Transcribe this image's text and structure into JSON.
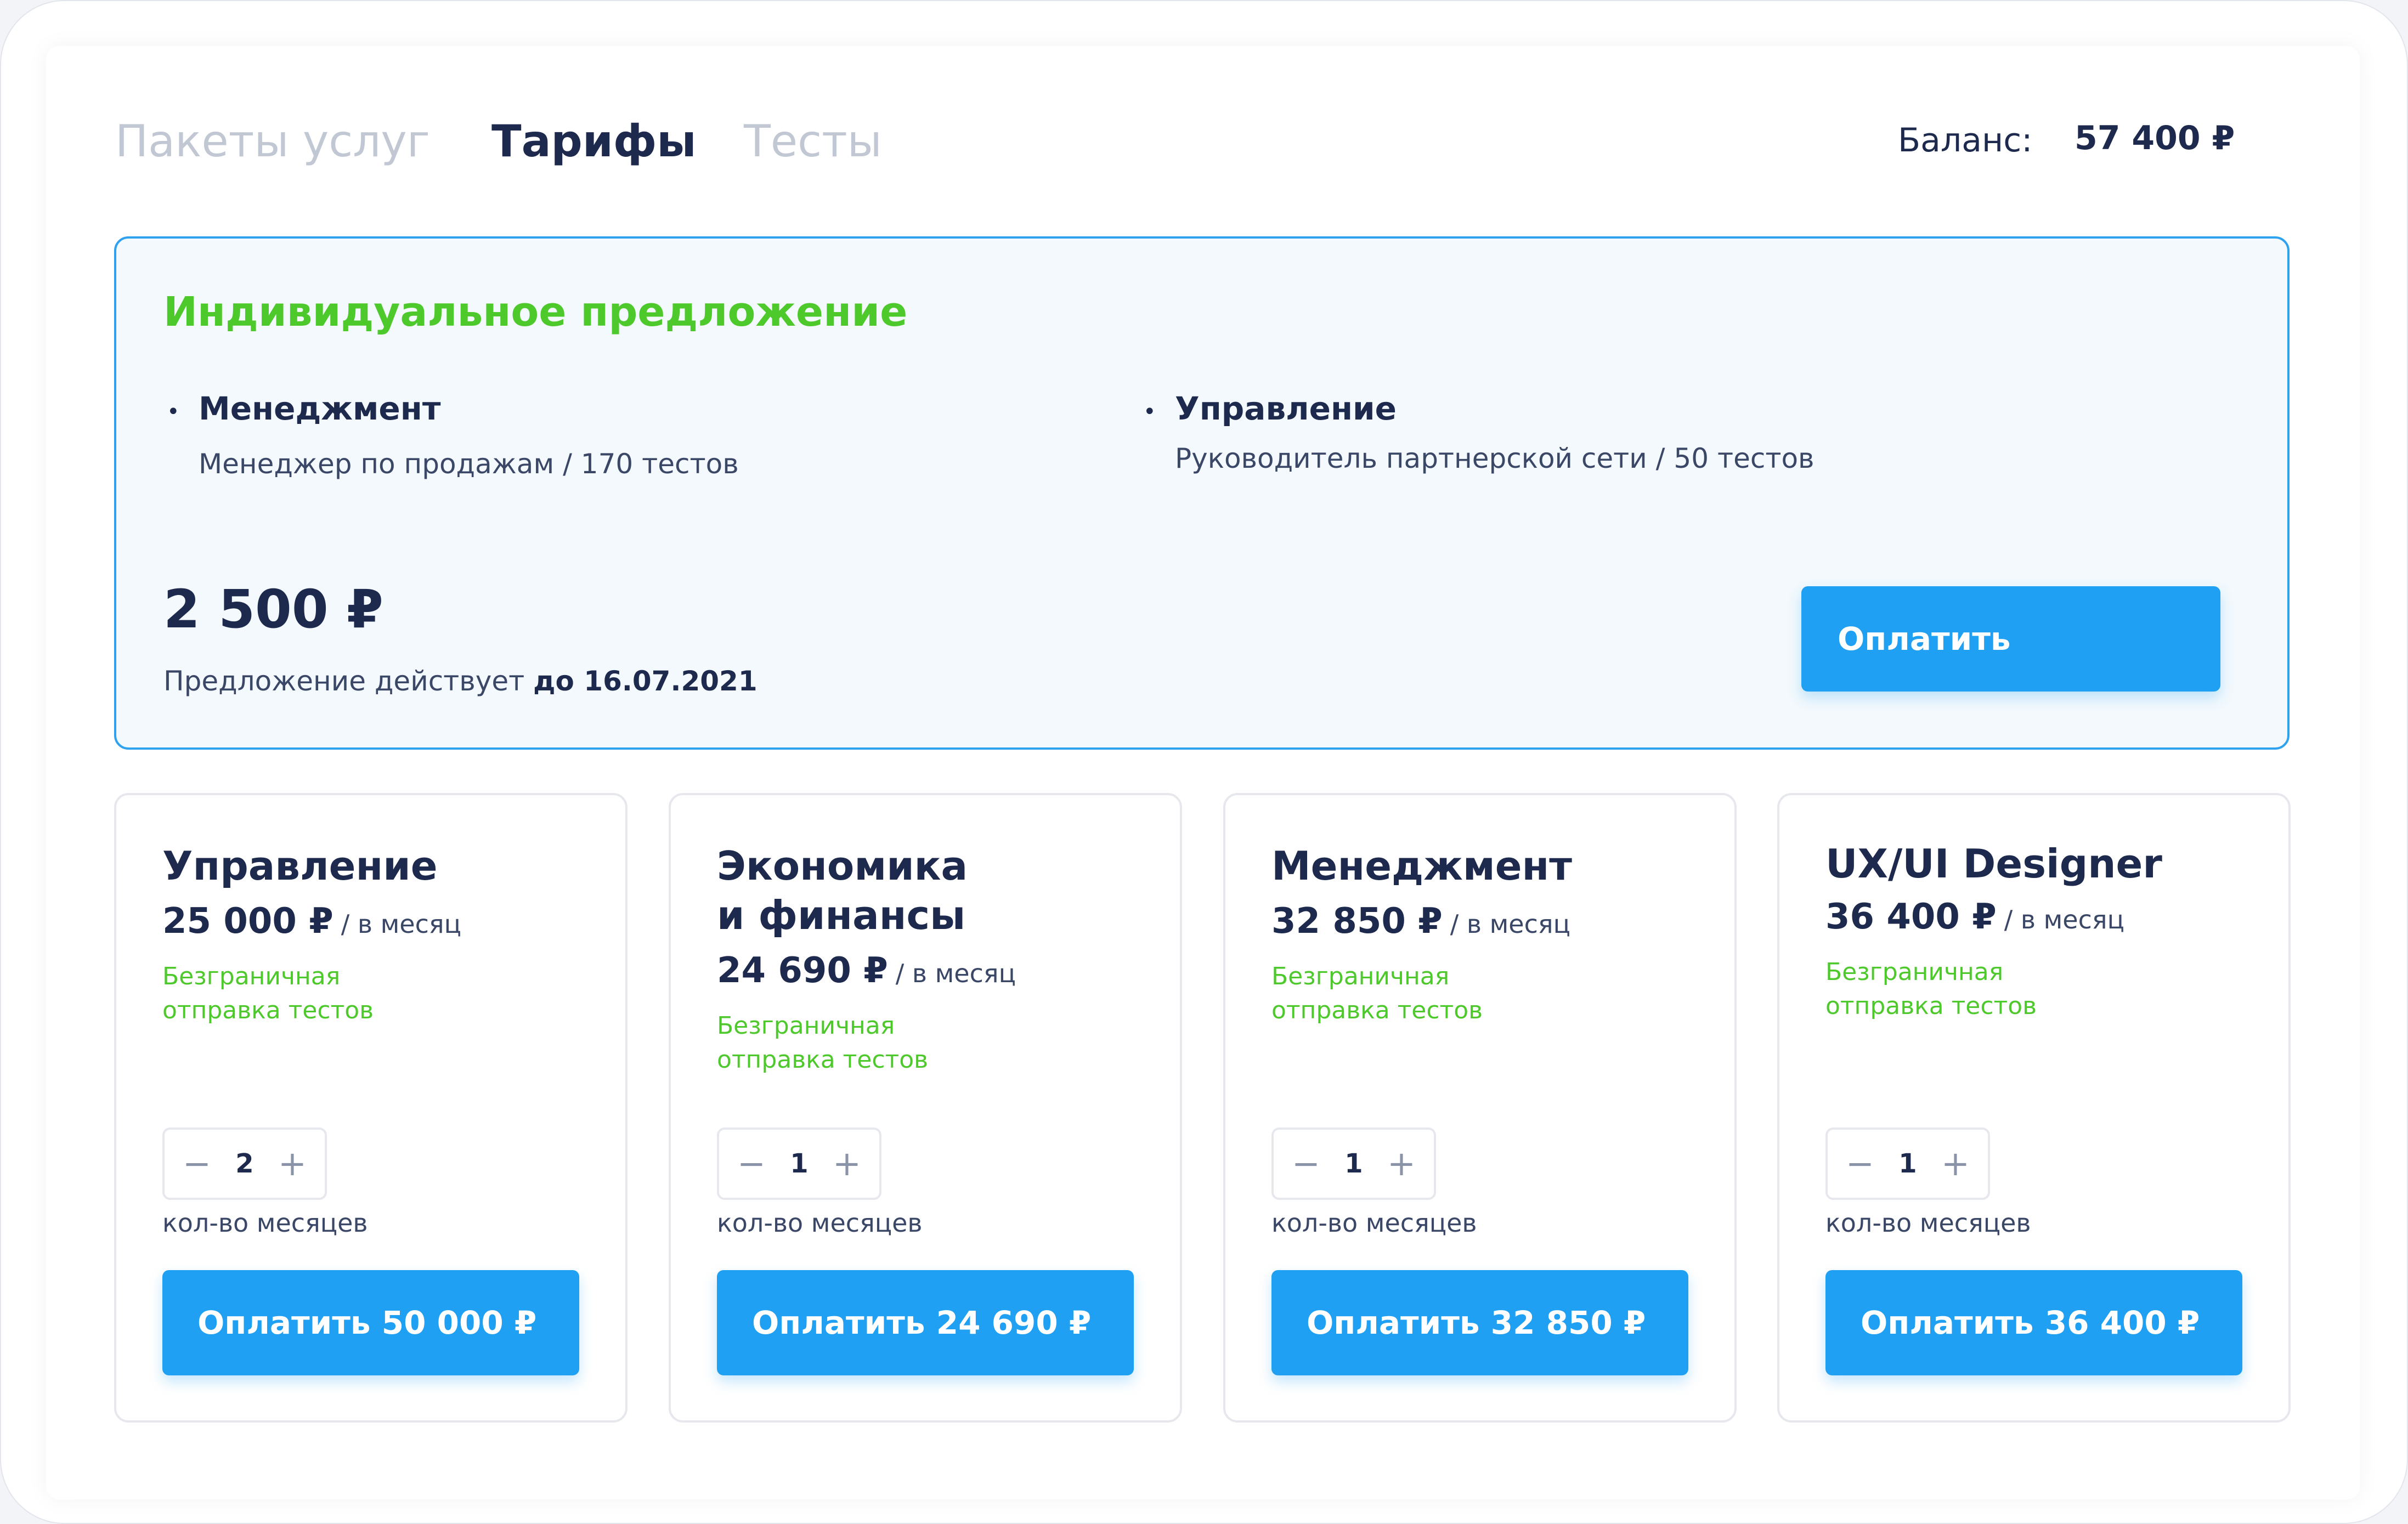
{
  "tabs": [
    {
      "label": "Пакеты услуг",
      "active": false
    },
    {
      "label": "Тарифы",
      "active": true
    },
    {
      "label": "Тесты",
      "active": false
    }
  ],
  "balance": {
    "label": "Баланс:",
    "value": "57 400 ₽"
  },
  "offer": {
    "title": "Индивидуальное предложение",
    "items": [
      {
        "name": "Менеджмент",
        "desc": "Менеджер по продажам / 170 тестов"
      },
      {
        "name": "Управление",
        "desc": "Руководитель партнерской сети / 50 тестов"
      }
    ],
    "price": "2 500 ₽",
    "note_prefix": "Предложение действует",
    "note_date": "до 16.07.2021",
    "pay_label": "Оплатить"
  },
  "colors": {
    "accent": "#1fa0f3",
    "green": "#4ec92c",
    "text": "#1d2a4d"
  },
  "cards": [
    {
      "title_line1": "Управление",
      "title_line2": "",
      "price": "25 000 ₽",
      "per": "/ в месяц",
      "feature_line1": "Безграничная",
      "feature_line2": "отправка тестов",
      "quantity": "2",
      "qty_label": "кол-во месяцев",
      "pay_label": "Оплатить 50 000 ₽"
    },
    {
      "title_line1": "Экономика",
      "title_line2": "и финансы",
      "price": "24 690 ₽",
      "per": "/ в месяц",
      "feature_line1": "Безграничная",
      "feature_line2": "отправка тестов",
      "quantity": "1",
      "qty_label": "кол-во месяцев",
      "pay_label": "Оплатить 24 690 ₽"
    },
    {
      "title_line1": "Менеджмент",
      "title_line2": "",
      "price": "32 850 ₽",
      "per": "/ в месяц",
      "feature_line1": "Безграничная",
      "feature_line2": "отправка тестов",
      "quantity": "1",
      "qty_label": "кол-во месяцев",
      "pay_label": "Оплатить 32 850 ₽"
    },
    {
      "title_line1": "UX/UI Designer",
      "title_line2": "",
      "price": "36 400 ₽",
      "per": "/ в месяц",
      "feature_line1": "Безграничная",
      "feature_line2": "отправка тестов",
      "quantity": "1",
      "qty_label": "кол-во месяцев",
      "pay_label": "Оплатить 36 400 ₽"
    }
  ],
  "icons": {
    "minus": "minus-icon",
    "plus": "plus-icon",
    "bullet": "bullet-icon"
  }
}
